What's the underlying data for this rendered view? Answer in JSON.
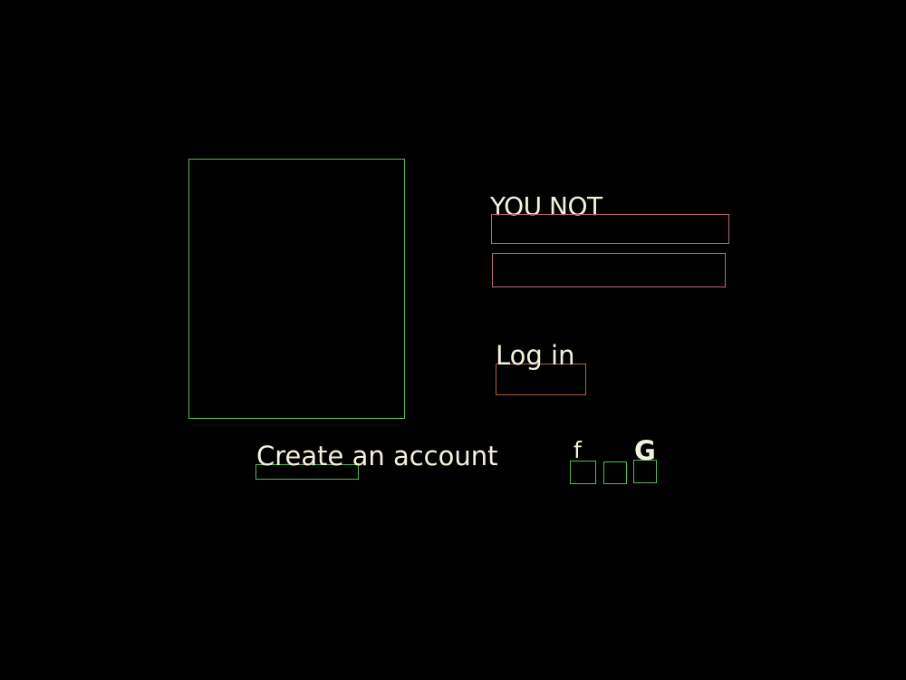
{
  "login": {
    "title": "YOU NOT",
    "username_value": "",
    "password_value": "",
    "login_label": "Log in",
    "create_account_label": "Create an account"
  },
  "social": {
    "facebook_glyph": "f",
    "google_glyph": "G",
    "icons": [
      "facebook-icon",
      "blank-social-icon",
      "google-icon"
    ]
  },
  "colors": {
    "background": "#000000",
    "text": "#f4f2dc",
    "green_outline": "#58b84f",
    "pink_outline": "#b8687c",
    "rust_outline": "#a8604c"
  }
}
